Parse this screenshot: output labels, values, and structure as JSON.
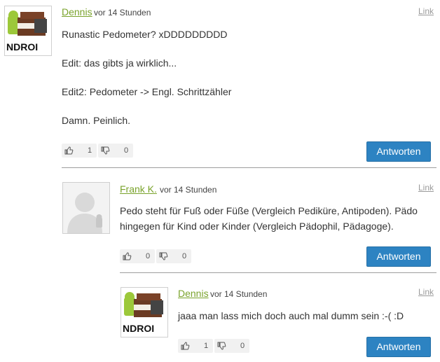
{
  "comments": [
    {
      "author": "Dennis",
      "time": "vor 14 Stunden",
      "link": "Link",
      "avatar": "android-ice-cream-sandwich-avatar",
      "lines": [
        "Runastic Pedometer? xDDDDDDDDD",
        "Edit: das gibts ja wirklich...",
        "Edit2: Pedometer -> Engl. Schrittzähler",
        "Damn. Peinlich."
      ],
      "likes": "1",
      "dislikes": "0",
      "reply_label": "Antworten"
    },
    {
      "author": "Frank K.",
      "time": "vor 14 Stunden",
      "link": "Link",
      "avatar": "default-user-silhouette-avatar",
      "lines": [
        "Pedo steht für Fuß oder Füße (Vergleich Pediküre, Antipoden). Pädo",
        "hingegen für Kind oder Kinder (Vergleich Pädophil, Pädagoge)."
      ],
      "likes": "0",
      "dislikes": "0",
      "reply_label": "Antworten"
    },
    {
      "author": "Dennis",
      "time": "vor 14 Stunden",
      "link": "Link",
      "avatar": "android-ice-cream-sandwich-avatar",
      "lines": [
        "jaaa man lass mich doch auch mal dumm sein :-( :D"
      ],
      "likes": "1",
      "dislikes": "0",
      "reply_label": "Antworten"
    }
  ],
  "avatar_text": "NDROI",
  "colors": {
    "author": "#7aa32c",
    "button": "#2d83c2",
    "separator": "#9d9d9d"
  }
}
